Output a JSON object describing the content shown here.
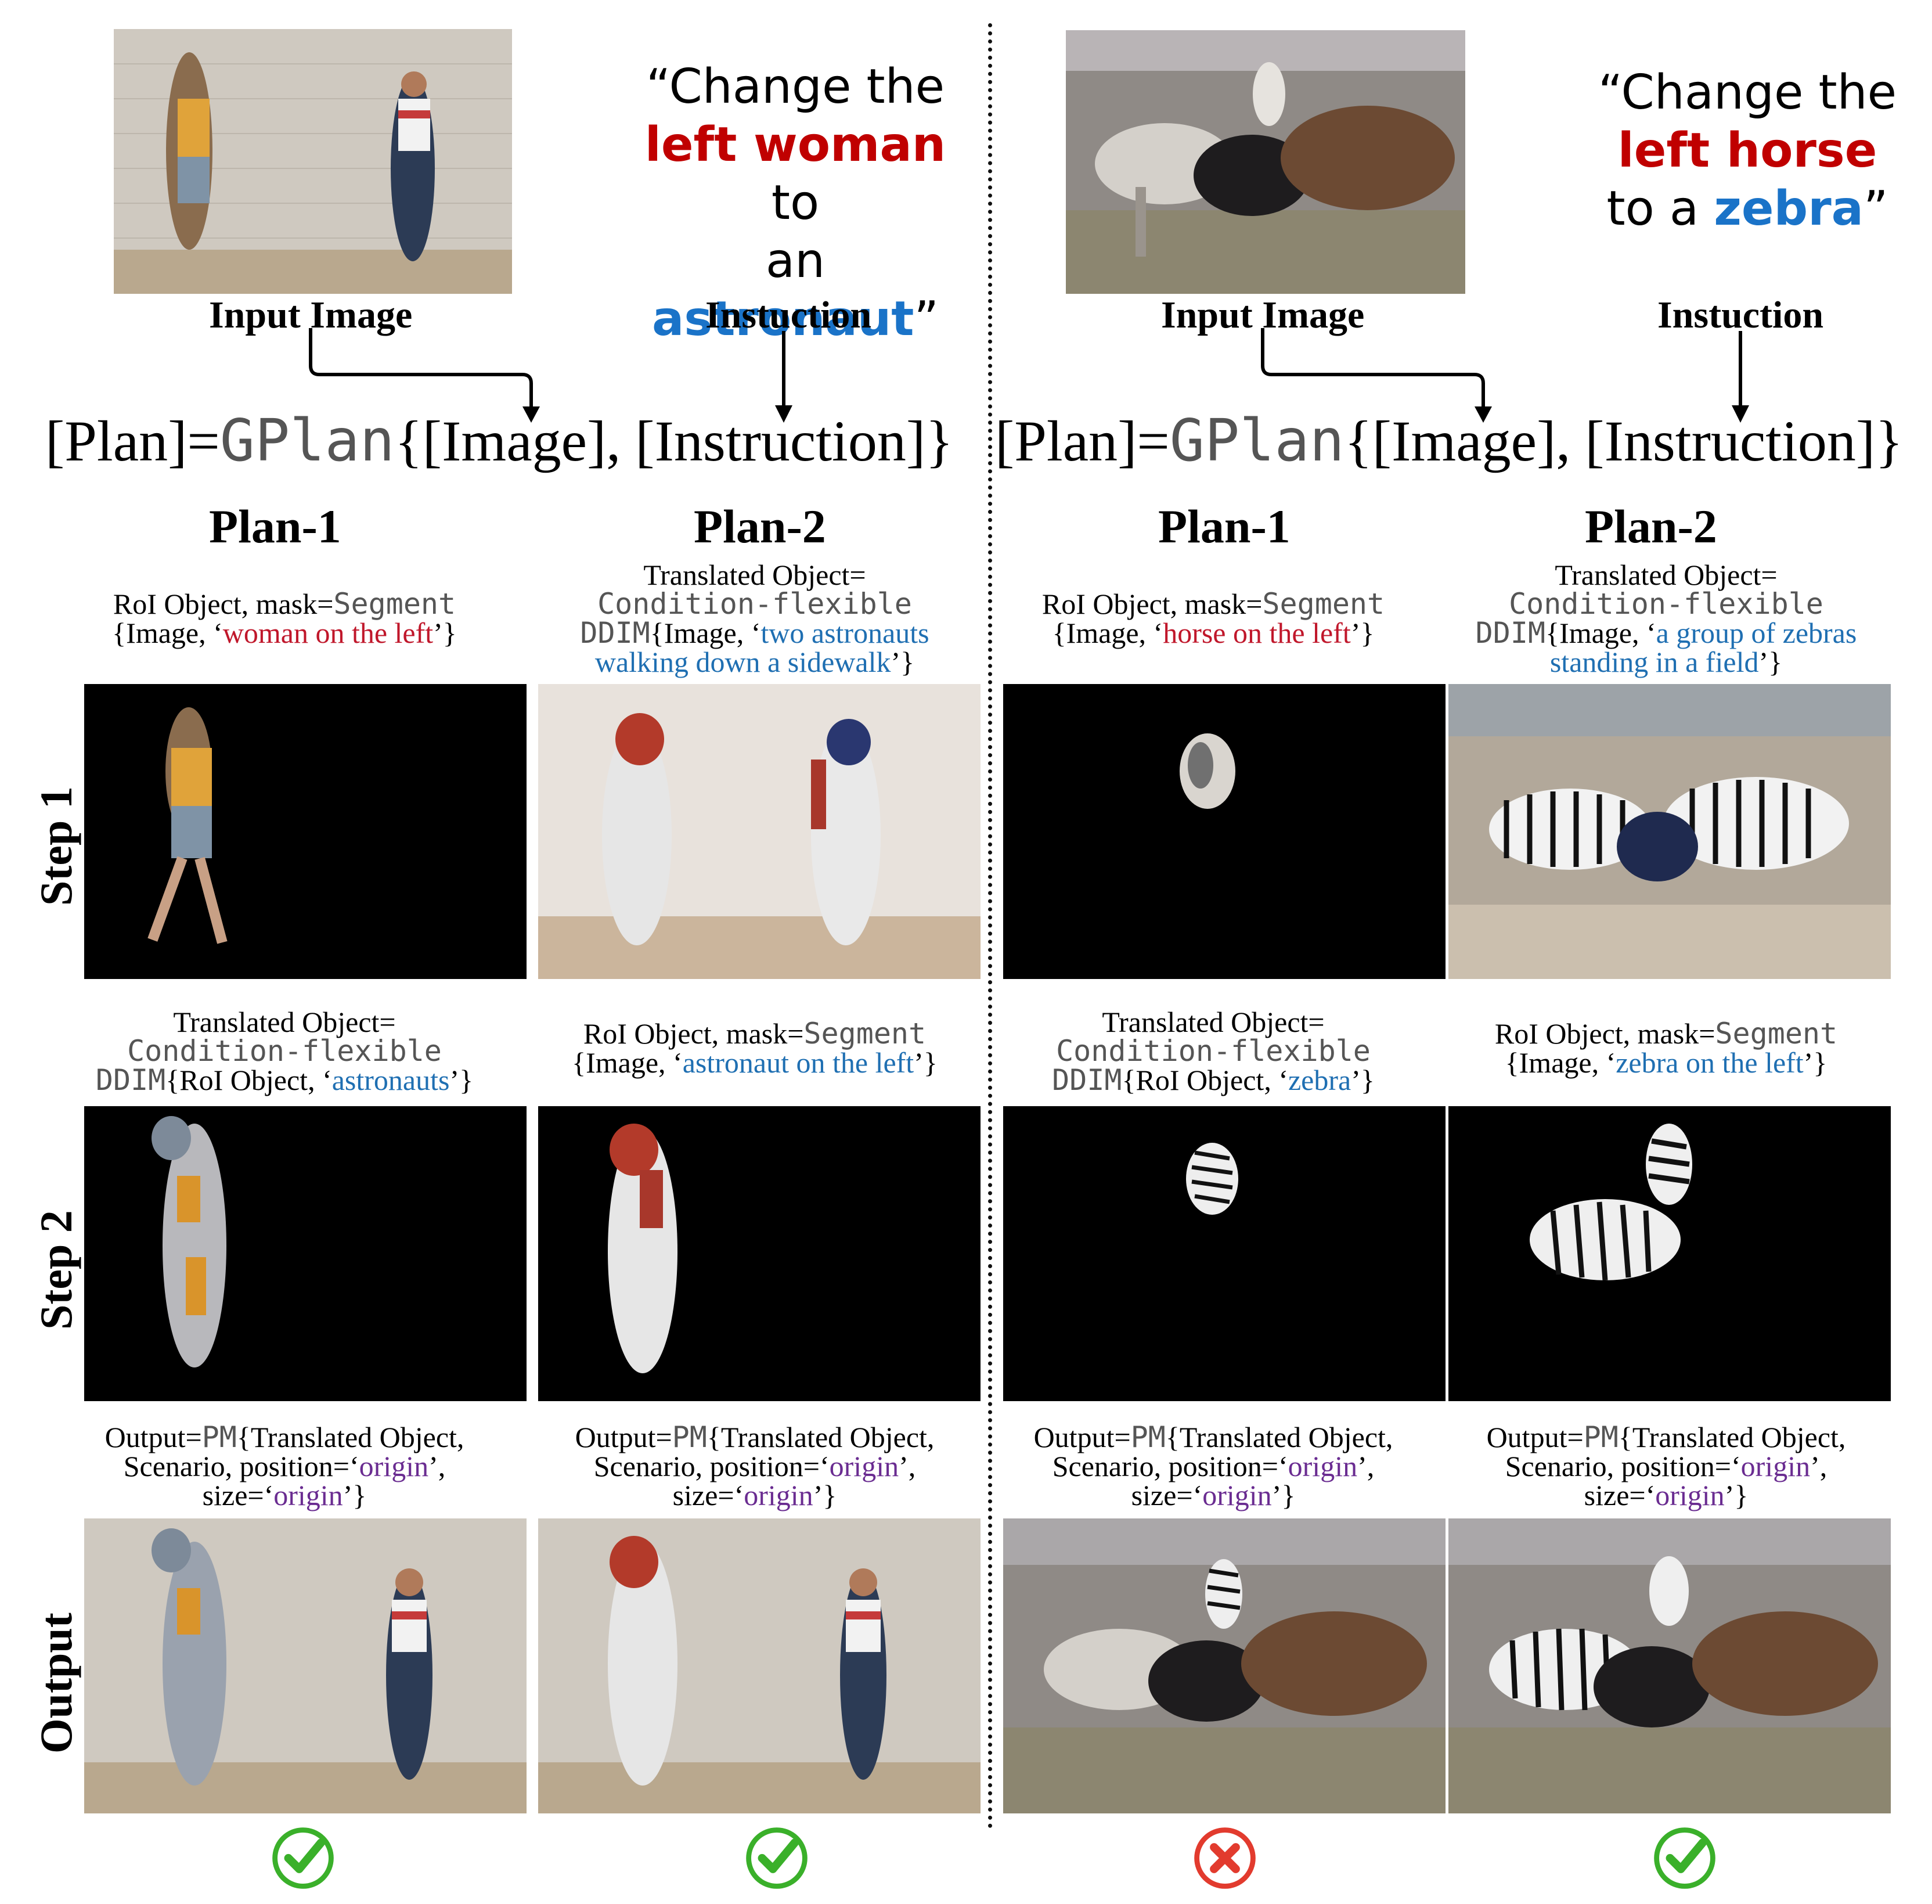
{
  "quotes": {
    "left": {
      "open": "“Change the",
      "red": "left woman",
      "mid": " to",
      "pre": "an ",
      "blue": "astronaut",
      "close": "”"
    },
    "right": {
      "open": "“Change the",
      "red": "left horse",
      "pre": "to a ",
      "blue": "zebra",
      "close": "”"
    }
  },
  "labels": {
    "input_image": "Input Image",
    "instruction": "Instuction"
  },
  "formula": {
    "left_part": "[Plan]=",
    "func": "GPlan",
    "args": "{[Image], [Instruction]}"
  },
  "plans": {
    "plan1": "Plan-1",
    "plan2": "Plan-2"
  },
  "rows": {
    "step1": "Step 1",
    "step2": "Step 2",
    "output": "Output"
  },
  "captions": {
    "seg_pre": "RoI Object, mask=",
    "seg_func": "Segment",
    "seg_img": "{Image, ‘",
    "seg_close": "’}",
    "trans_pre": "Translated Object=",
    "trans_func": "Condition-flexible",
    "ddim": "DDIM",
    "ddim_img": "{Image, ‘",
    "ddim_roi": "{RoI Object, ‘",
    "close": "’}",
    "out_pre": "Output=",
    "pm": "PM",
    "out_mid": "{Translated Object,",
    "out_line2a": "Scenario, position=‘",
    "origin": "origin",
    "out_line2b": "’,",
    "out_line3a": "size=‘",
    "out_line3b": "’}",
    "woman_left": "woman on the left",
    "two_astronauts_1": "two astronauts",
    "two_astronauts_2": "walking down a sidewalk",
    "astronauts": "astronauts",
    "astronaut_left": "astronaut on the left",
    "horse_left": "horse on the left",
    "zebras_1": "a group of zebras",
    "zebras_2": "standing in a field",
    "zebra": "zebra",
    "zebra_left": "zebra on the left"
  },
  "results": [
    "check",
    "check",
    "cross",
    "check"
  ],
  "colors": {
    "red": "#c0172b",
    "blue": "#1f6fb2",
    "purple": "#6a2c91",
    "check": "#3ab02a",
    "cross": "#e23b2e"
  }
}
